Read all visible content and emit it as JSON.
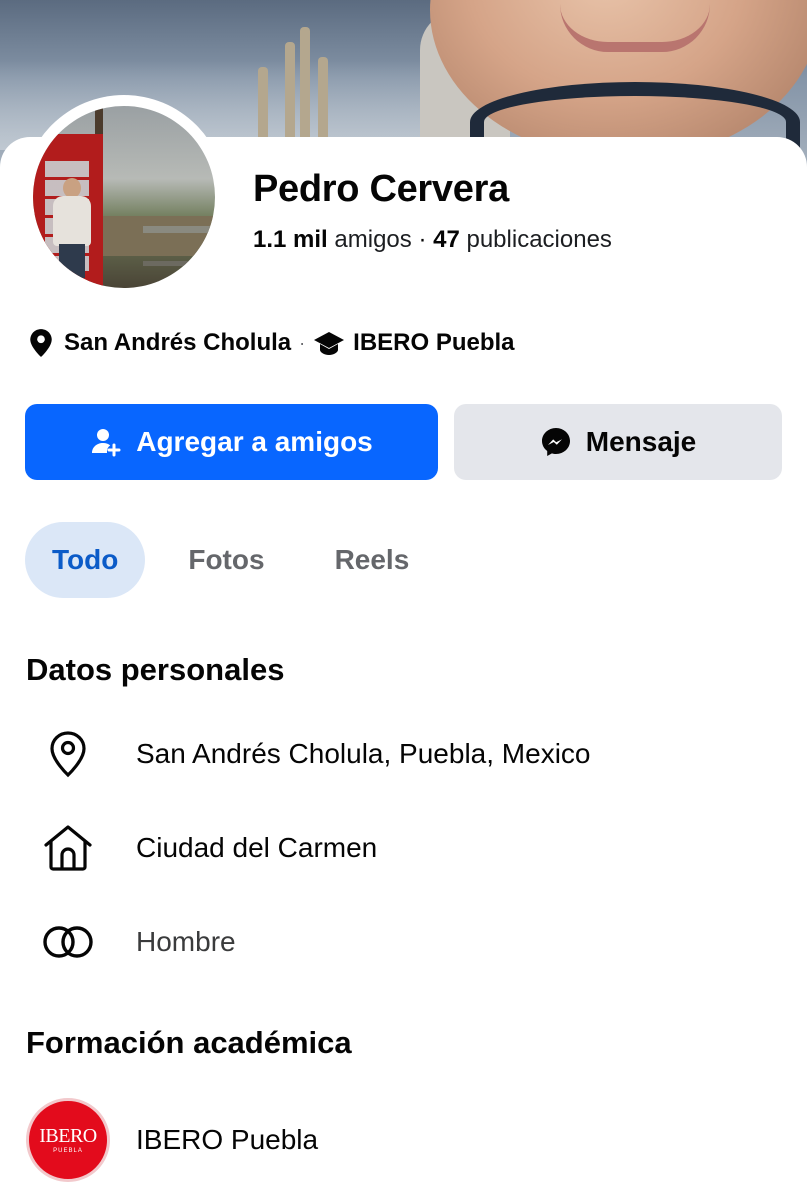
{
  "profile": {
    "name": "Pedro Cervera",
    "friends_count": "1.1 mil",
    "friends_label": "amigos",
    "separator": "·",
    "posts_count": "47",
    "posts_label": "publicaciones"
  },
  "meta": {
    "location": "San Andrés Cholula",
    "separator": "·",
    "school": "IBERO Puebla"
  },
  "actions": {
    "add_friend_label": "Agregar a amigos",
    "message_label": "Mensaje"
  },
  "tabs": [
    {
      "label": "Todo",
      "active": true
    },
    {
      "label": "Fotos",
      "active": false
    },
    {
      "label": "Reels",
      "active": false
    }
  ],
  "personal": {
    "title": "Datos personales",
    "items": [
      {
        "icon": "location-pin-icon",
        "text": "San Andrés Cholula, Puebla, Mexico"
      },
      {
        "icon": "home-icon",
        "text": "Ciudad del Carmen"
      },
      {
        "icon": "gender-icon",
        "text": "Hombre"
      }
    ]
  },
  "education": {
    "title": "Formación académica",
    "logo_text": "IBERO",
    "logo_subtext": "PUEBLA",
    "school": "IBERO Puebla"
  },
  "colors": {
    "primary": "#0866ff",
    "secondary_bg": "#e4e6eb",
    "active_tab_bg": "#dbe7f7",
    "active_tab_text": "#0b5bc8",
    "muted_text": "#65676b",
    "ibero_red": "#e30b1c"
  }
}
